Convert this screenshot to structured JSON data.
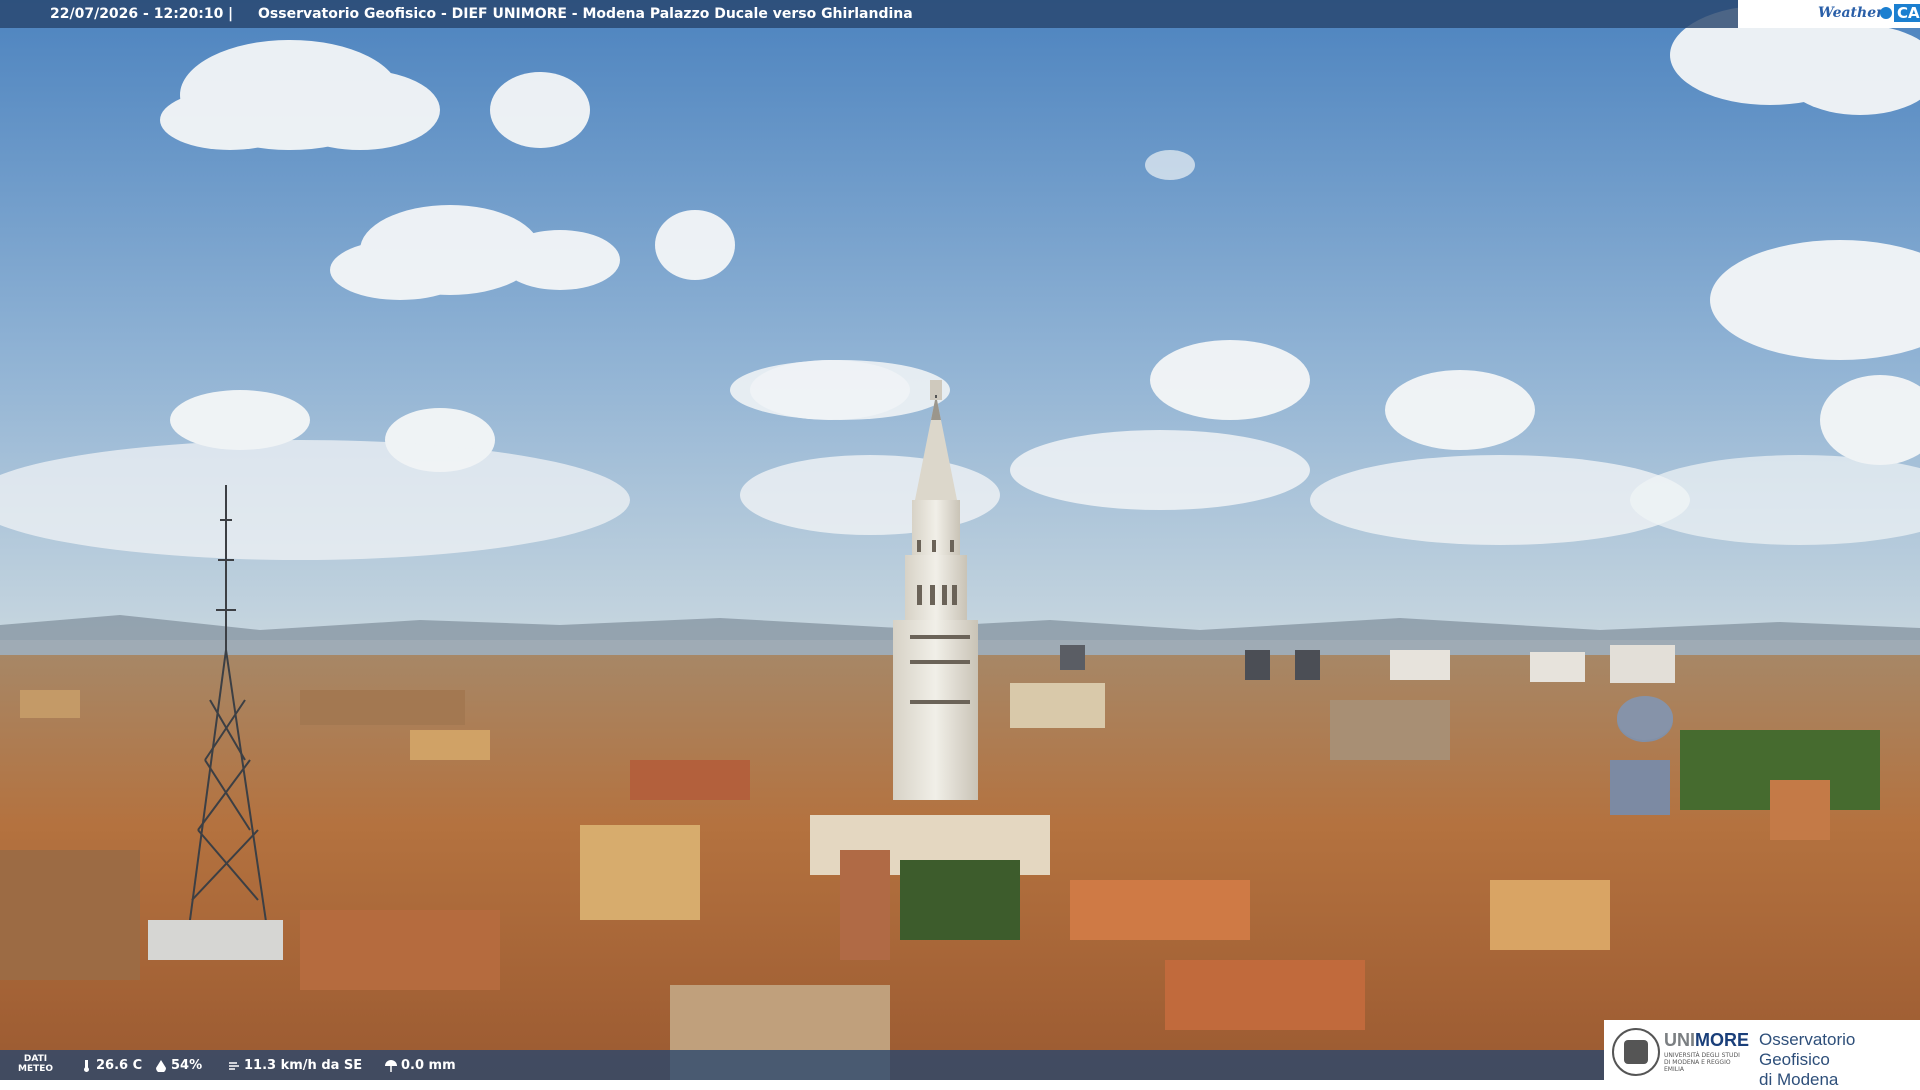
{
  "header": {
    "timestamp": "22/07/2026 - 12:20:10",
    "separator": "|",
    "caption": "Osservatorio Geofisico - DIEF UNIMORE - Modena Palazzo Ducale verso Ghirlandina",
    "logo_weather": "Weather",
    "logo_cam": "CAM"
  },
  "weather": {
    "label_line1": "DATI",
    "label_line2": "METEO",
    "temperature": "26.6 C",
    "humidity": "54%",
    "wind": "11.3 km/h da SE",
    "rain": "0.0 mm"
  },
  "branding": {
    "university_part1": "UNI",
    "university_part2": "MORE",
    "university_sub": "UNIVERSITÀ DEGLI STUDI DI MODENA E REGGIO EMILIA",
    "observatory_line1": "Osservatorio Geofisico",
    "observatory_line2": "di Modena"
  },
  "colors": {
    "sky_top": "#4f86c1",
    "sky_horizon": "#b9cfdf",
    "roof": "#b66e3f",
    "tower": "#e6e2d8"
  }
}
